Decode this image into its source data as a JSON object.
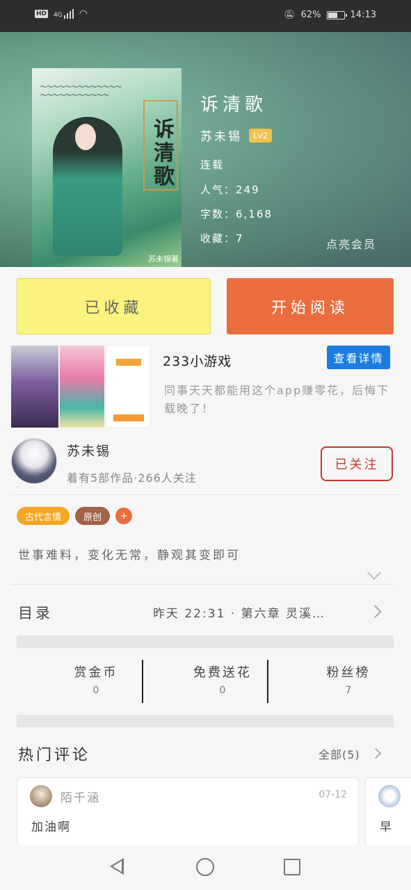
{
  "status_bar": {
    "network": "HD",
    "signal": "4G",
    "battery": "62%",
    "battery_level": 0.62,
    "time": "14:13"
  },
  "book": {
    "title": "诉清歌",
    "author": "苏未锡",
    "level": "Lv2",
    "status": "连载",
    "popularity": "人气：249",
    "words": "字数：6,168",
    "favorites": "收藏：7",
    "cover_text": "诉清歌",
    "cover_signature": "苏未锡著"
  },
  "vip_link": "点亮会员",
  "actions": {
    "collected": "已收藏",
    "start_reading": "开始阅读"
  },
  "ad": {
    "title": "233小游戏",
    "detail_button": "查看详情",
    "description": "同事天天都能用这个app赚零花，后悔下载晚了！"
  },
  "author_card": {
    "name": "苏未锡",
    "stats": "着有5部作品·266人关注",
    "follow": "已关注"
  },
  "tags": [
    "古代言情",
    "原创"
  ],
  "tag_add": "+",
  "intro": "世事难料，变化无常，静观其变即可",
  "catalog": {
    "label": "目录",
    "latest": "昨天 22:31 · 第六章  灵溪…"
  },
  "stats": [
    {
      "label": "赏金币",
      "value": "0"
    },
    {
      "label": "免费送花",
      "value": "0"
    },
    {
      "label": "粉丝榜",
      "value": "7"
    }
  ],
  "comments": {
    "heading": "热门评论",
    "all": "全部(5)",
    "items": [
      {
        "user": "陌千涵",
        "date": "07-12",
        "text": "加油啊"
      },
      {
        "user": "",
        "date": "",
        "text": "早"
      }
    ]
  }
}
